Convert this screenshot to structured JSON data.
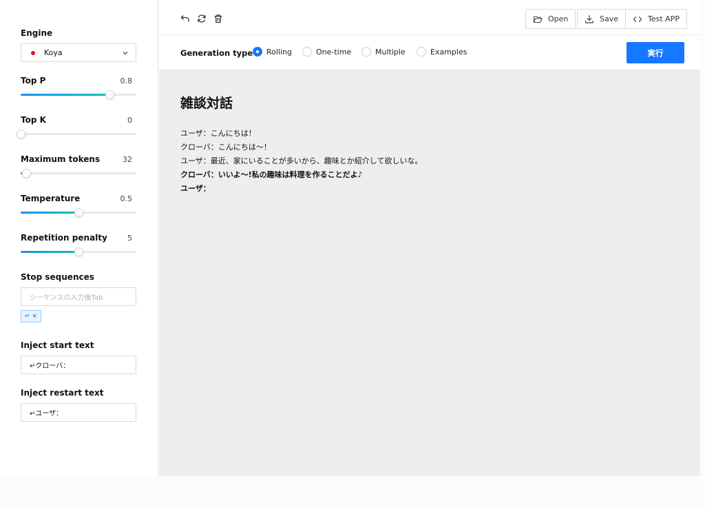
{
  "sidebar": {
    "engine": {
      "label": "Engine",
      "value": "Koya",
      "dot_color": "#e3121e"
    },
    "top_p": {
      "label": "Top P",
      "value": "0.8",
      "fraction": 0.77
    },
    "top_k": {
      "label": "Top K",
      "value": "0",
      "fraction": 0.0
    },
    "max_tokens": {
      "label": "Maximum tokens",
      "value": "32",
      "fraction": 0.05
    },
    "temperature": {
      "label": "Temperature",
      "value": "0.5",
      "fraction": 0.5
    },
    "repetition_penalty": {
      "label": "Repetition penalty",
      "value": "5",
      "fraction": 0.5
    },
    "stop_sequences": {
      "label": "Stop sequences",
      "placeholder": "シーケンスの入力後Tab",
      "tag": "↵",
      "tag_close": "×"
    },
    "inject_start": {
      "label": "Inject start text",
      "value": "↵クローバ："
    },
    "inject_restart": {
      "label": "Inject restart text",
      "value": "↵ユーザ："
    }
  },
  "toolbar": {
    "open_label": "Open",
    "save_label": "Save",
    "test_label": "Test APP"
  },
  "generation": {
    "label": "Generation type",
    "options": [
      {
        "label": "Rolling",
        "checked": true
      },
      {
        "label": "One-time",
        "checked": false
      },
      {
        "label": "Multiple",
        "checked": false
      },
      {
        "label": "Examples",
        "checked": false
      }
    ],
    "run_label": "実行"
  },
  "editor": {
    "title": "雑談対話",
    "lines": [
      {
        "text": "ユーザ：こんにちは！",
        "bold": false
      },
      {
        "text": "クローバ：こんにちは～！",
        "bold": false
      },
      {
        "text": "ユーザ：最近、家にいることが多いから、趣味とか紹介して欲しいな。",
        "bold": false
      },
      {
        "text": "クローバ：いいよ～!私の趣味は料理を作ることだよ♪",
        "bold": true
      },
      {
        "text": "ユーザ：",
        "bold": true
      }
    ]
  },
  "colors": {
    "accent": "#1677ff",
    "slider_gradient_start": "#1a8cff",
    "slider_gradient_end": "#13c2a5",
    "editor_bg": "#eeeeee"
  }
}
